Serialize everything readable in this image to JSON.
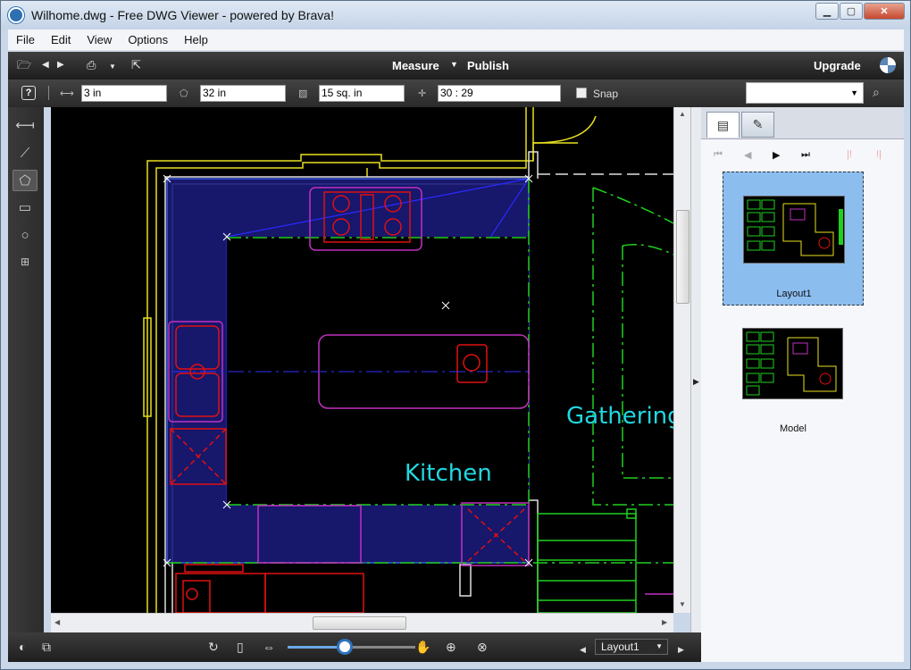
{
  "window": {
    "title": "Wilhome.dwg - Free DWG Viewer - powered by Brava!",
    "min_glyph": "▁",
    "max_glyph": "▢",
    "close_glyph": "✕"
  },
  "menu": [
    "File",
    "Edit",
    "View",
    "Options",
    "Help"
  ],
  "toolbar": {
    "measure_label": "Measure",
    "publish_label": "Publish",
    "upgrade_label": "Upgrade"
  },
  "measurebar": {
    "help_glyph": "?",
    "length": "3 in",
    "perimeter": "32 in",
    "area": "15 sq. in",
    "coordinates": "30 : 29",
    "snap_label": "Snap",
    "snap_checked": false
  },
  "drawing": {
    "room_labels": [
      "Kitchen",
      "Gathering"
    ],
    "colors": {
      "yellow": "#e8e020",
      "white": "#e0e0e0",
      "magenta": "#c030c0",
      "green": "#20d020",
      "red": "#e01010",
      "blue_fill": "#1a1a78",
      "cyan_text": "#20d8e0"
    }
  },
  "panel": {
    "tabs": [
      "layouts-tab",
      "markups-tab"
    ],
    "thumbnails": [
      {
        "label": "Layout1",
        "selected": true
      },
      {
        "label": "Model",
        "selected": false
      }
    ]
  },
  "bottombar": {
    "layout_selected": "Layout1",
    "zoom_fraction": 0.46
  }
}
